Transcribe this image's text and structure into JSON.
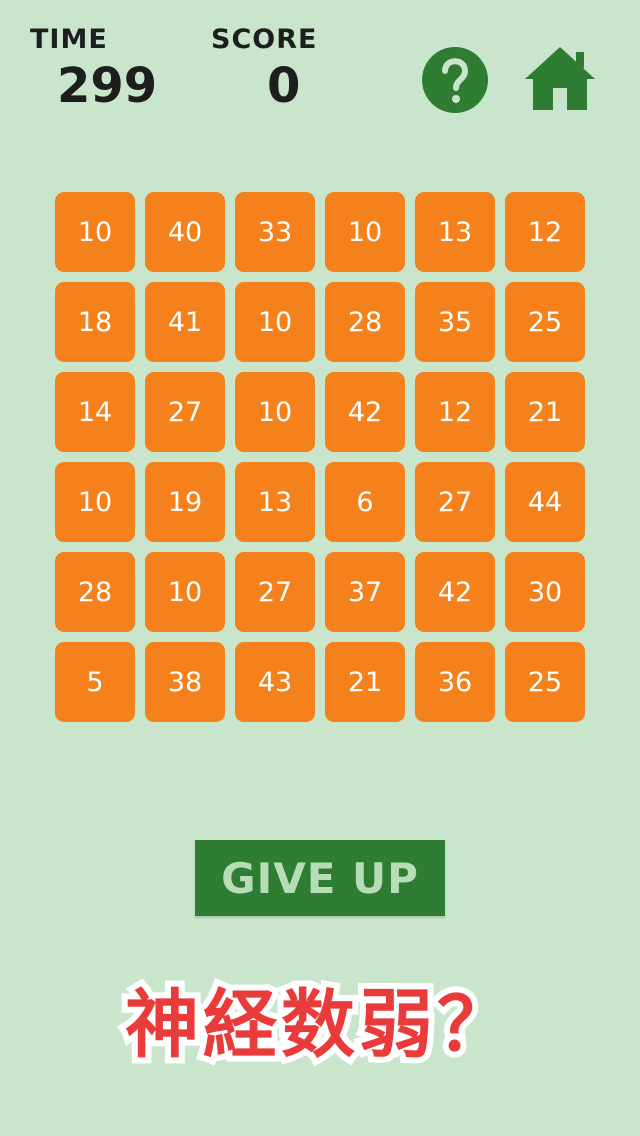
{
  "hud": {
    "time_label": "TIME",
    "time_value": "299",
    "score_label": "SCORE",
    "score_value": "0"
  },
  "icons": {
    "help": "question-icon",
    "home": "home-icon",
    "icon_color": "#2e7d32"
  },
  "grid": {
    "columns": 6,
    "tile_color": "#f4811c",
    "tiles": [
      [
        "10",
        "40",
        "33",
        "10",
        "13",
        "12"
      ],
      [
        "18",
        "41",
        "10",
        "28",
        "35",
        "25"
      ],
      [
        "14",
        "27",
        "10",
        "42",
        "12",
        "21"
      ],
      [
        "10",
        "19",
        "13",
        "6",
        "27",
        "44"
      ],
      [
        "28",
        "10",
        "27",
        "37",
        "42",
        "30"
      ],
      [
        "5",
        "38",
        "43",
        "21",
        "36",
        "25"
      ]
    ]
  },
  "give_up_label": "GIVE UP",
  "banner_text": "神経数弱？",
  "colors": {
    "background": "#c9e6cd",
    "banner": "#ea3b3b",
    "button": "#2e7d32"
  }
}
